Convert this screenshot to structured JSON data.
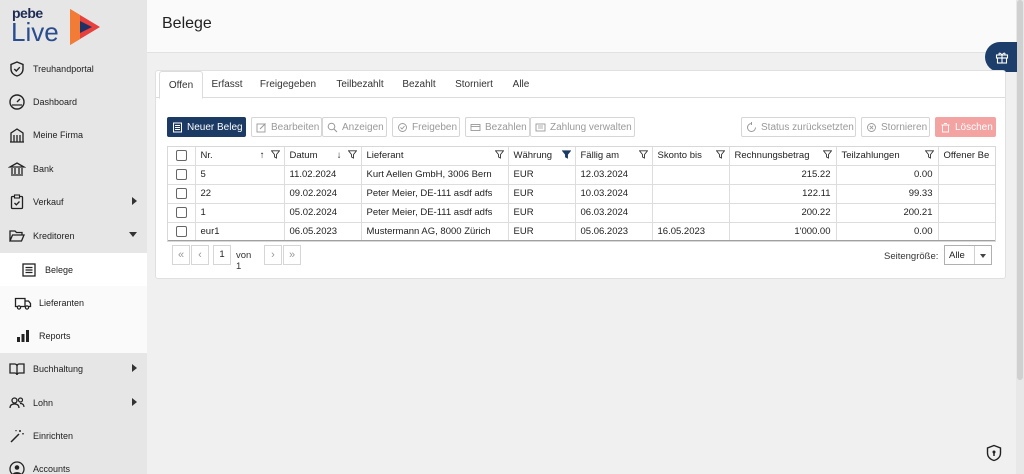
{
  "logo": {
    "pebe": "pebe",
    "live": "Live"
  },
  "nav": [
    {
      "name": "treuhandportal",
      "label": "Treuhandportal"
    },
    {
      "name": "dashboard",
      "label": "Dashboard"
    },
    {
      "name": "meine-firma",
      "label": "Meine Firma"
    },
    {
      "name": "bank",
      "label": "Bank"
    },
    {
      "name": "verkauf",
      "label": "Verkauf"
    },
    {
      "name": "kreditoren",
      "label": "Kreditoren"
    },
    {
      "name": "belege",
      "label": "Belege"
    },
    {
      "name": "lieferanten",
      "label": "Lieferanten"
    },
    {
      "name": "reports",
      "label": "Reports"
    },
    {
      "name": "buchhaltung",
      "label": "Buchhaltung"
    },
    {
      "name": "lohn",
      "label": "Lohn"
    },
    {
      "name": "einrichten",
      "label": "Einrichten"
    },
    {
      "name": "accounts",
      "label": "Accounts"
    }
  ],
  "header": {
    "title": "Belege"
  },
  "tabs": [
    "Offen",
    "Erfasst",
    "Freigegeben",
    "Teilbezahlt",
    "Bezahlt",
    "Storniert",
    "Alle"
  ],
  "toolbar": {
    "new": "Neuer Beleg",
    "edit": "Bearbeiten",
    "view": "Anzeigen",
    "approve": "Freigeben",
    "pay": "Bezahlen",
    "manage_payment": "Zahlung verwalten",
    "reset_status": "Status zurücksetzten",
    "cancel": "Stornieren",
    "delete": "Löschen"
  },
  "table": {
    "columns": [
      "Nr.",
      "Datum",
      "Lieferant",
      "Währung",
      "Fällig am",
      "Skonto bis",
      "Rechnungsbetrag",
      "Teilzahlungen",
      "Offener Be"
    ],
    "rows": [
      [
        "5",
        "11.02.2024",
        "Kurt Aellen GmbH, 3006 Bern",
        "EUR",
        "12.03.2024",
        "",
        "215.22",
        "0.00",
        ""
      ],
      [
        "22",
        "09.02.2024",
        "Peter Meier, DE-111 asdf adfs",
        "EUR",
        "10.03.2024",
        "",
        "122.11",
        "99.33",
        ""
      ],
      [
        "1",
        "05.02.2024",
        "Peter Meier, DE-111 asdf adfs",
        "EUR",
        "06.03.2024",
        "",
        "200.22",
        "200.21",
        ""
      ],
      [
        "eur1",
        "06.05.2023",
        "Mustermann AG, 8000 Zürich",
        "EUR",
        "05.06.2023",
        "16.05.2023",
        "1'000.00",
        "0.00",
        ""
      ]
    ]
  },
  "pager": {
    "page": "1",
    "of": "von 1",
    "size_label": "Seitengröße:",
    "size_value": "Alle"
  },
  "colors": {
    "primary": "#1b3a64",
    "danger": "#f4a3a3",
    "sidebar": "#e6e6e6"
  }
}
